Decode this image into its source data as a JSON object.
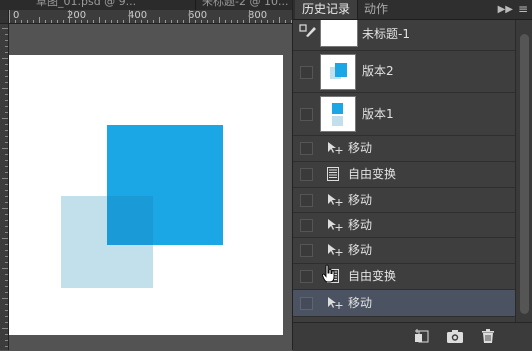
{
  "document_tabs": [
    {
      "label": "草图_01.psd @ 9..."
    },
    {
      "label": "未标题-2 @ 10..."
    }
  ],
  "ruler": {
    "labels": [
      "0",
      "200",
      "400",
      "600",
      "800"
    ]
  },
  "panel": {
    "tabs": [
      {
        "label": "历史记录",
        "active": true
      },
      {
        "label": "动作",
        "active": false
      }
    ],
    "collapse_icon": "double-chevron-right-icon",
    "menu_icon": "panel-menu-icon"
  },
  "history": {
    "snapshots": [
      {
        "label": "未标题-1",
        "thumb": "blank"
      },
      {
        "label": "版本2",
        "thumb": "overlap-squares"
      },
      {
        "label": "版本1",
        "thumb": "stacked-squares"
      }
    ],
    "states": [
      {
        "label": "移动",
        "icon": "move-tool-icon",
        "selected": false
      },
      {
        "label": "自由变换",
        "icon": "document-icon",
        "selected": false
      },
      {
        "label": "移动",
        "icon": "move-tool-icon",
        "selected": false
      },
      {
        "label": "移动",
        "icon": "move-tool-icon",
        "selected": false
      },
      {
        "label": "移动",
        "icon": "move-tool-icon",
        "selected": false
      },
      {
        "label": "自由变换",
        "icon": "document-icon",
        "selected": false
      },
      {
        "label": "移动",
        "icon": "move-tool-icon",
        "selected": true
      }
    ]
  },
  "footer": {
    "buttons": [
      "new-document-from-state-icon",
      "camera-snapshot-icon",
      "trash-icon"
    ]
  },
  "colors": {
    "accent_blue": "#1ba6e6",
    "light_blue": "#c1e0ec",
    "selected_row": "#4b5261",
    "panel_bg": "#3e3e3e"
  }
}
